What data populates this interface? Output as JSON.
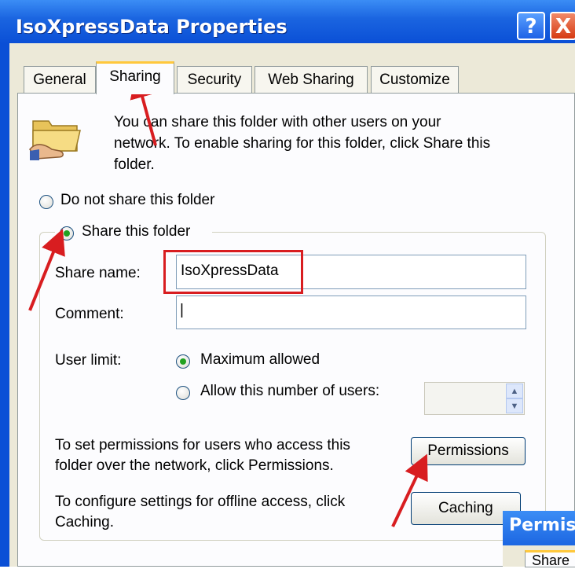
{
  "window": {
    "title": "IsoXpressData Properties",
    "help_label": "?",
    "close_label": "X"
  },
  "tabs": [
    {
      "label": "General"
    },
    {
      "label": "Sharing"
    },
    {
      "label": "Security"
    },
    {
      "label": "Web Sharing"
    },
    {
      "label": "Customize"
    }
  ],
  "sharing": {
    "intro": [
      "You can share this folder with other users on your",
      "network.  To enable sharing for this folder, click Share this",
      "folder."
    ],
    "option_no_share": "Do not share this folder",
    "option_share": "Share this folder",
    "share_name_label": "Share name:",
    "share_name_value": "IsoXpressData",
    "comment_label": "Comment:",
    "comment_value": "|",
    "user_limit_label": "User limit:",
    "option_max": "Maximum allowed",
    "option_allow": "Allow this number of users:",
    "permissions_text": [
      "To set permissions for users who access this",
      "folder over the network, click Permissions."
    ],
    "permissions_button": "Permissions",
    "caching_text": [
      "To configure settings for offline access, click",
      "Caching."
    ],
    "caching_button": "Caching"
  },
  "second_window": {
    "title": "Permis",
    "tab": "Share"
  },
  "colors": {
    "titlebar": "#0a4fd6",
    "annotation": "#d81d20",
    "radio_selected": "#21a121"
  }
}
